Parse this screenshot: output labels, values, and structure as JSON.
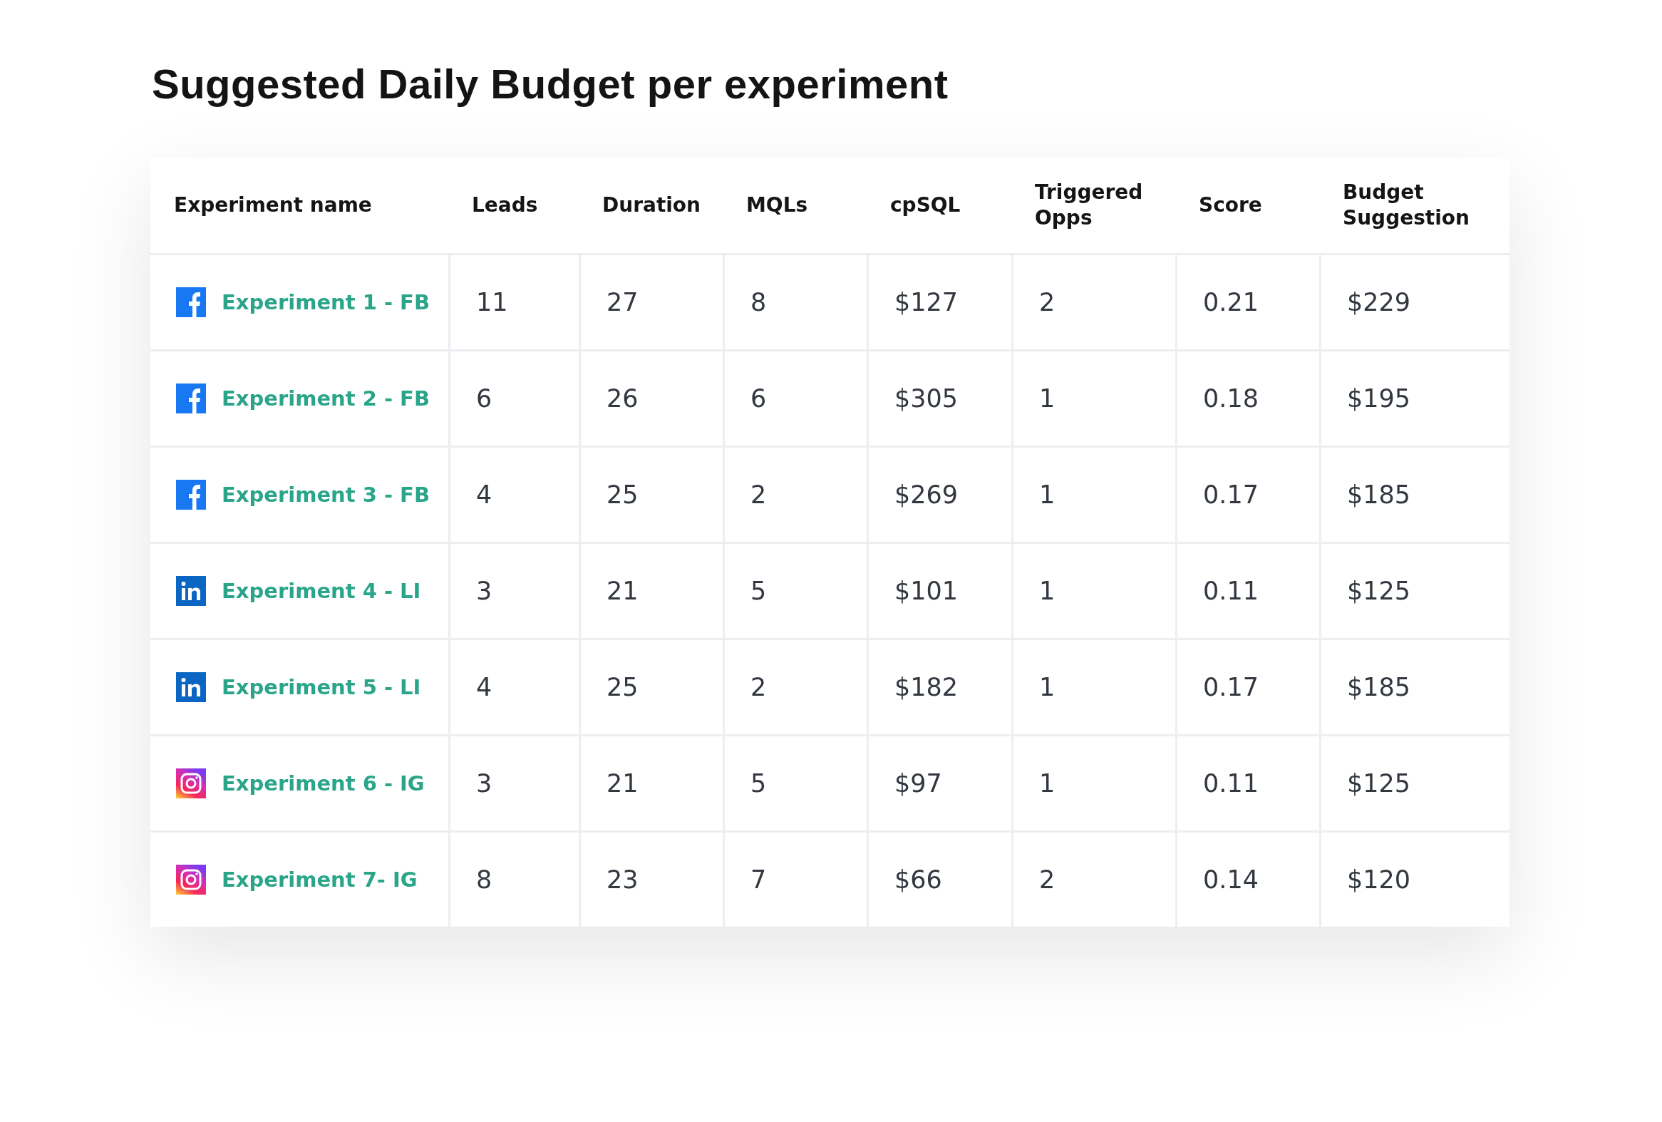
{
  "title": "Suggested Daily Budget per experiment",
  "table": {
    "columns": [
      "Experiment name",
      "Leads",
      "Duration",
      "MQLs",
      "cpSQL",
      "Triggered Opps",
      "Score",
      "Budget Suggestion"
    ],
    "rows": [
      {
        "kind": "facebook",
        "cells": [
          "Experiment 1 - FB",
          "11",
          "27",
          "8",
          "$127",
          "2",
          "0.21",
          "$229"
        ]
      },
      {
        "kind": "facebook",
        "cells": [
          "Experiment 2 - FB",
          "6",
          "26",
          "6",
          "$305",
          "1",
          "0.18",
          "$195"
        ]
      },
      {
        "kind": "facebook",
        "cells": [
          "Experiment 3 - FB",
          "4",
          "25",
          "2",
          "$269",
          "1",
          "0.17",
          "$185"
        ]
      },
      {
        "kind": "linkedin",
        "cells": [
          "Experiment 4 - LI",
          "3",
          "21",
          "5",
          "$101",
          "1",
          "0.11",
          "$125"
        ]
      },
      {
        "kind": "linkedin",
        "cells": [
          "Experiment 5 - LI",
          "4",
          "25",
          "2",
          "$182",
          "1",
          "0.17",
          "$185"
        ]
      },
      {
        "kind": "instagram",
        "cells": [
          "Experiment 6 - IG",
          "3",
          "21",
          "5",
          "$97",
          "1",
          "0.11",
          "$125"
        ]
      },
      {
        "kind": "instagram",
        "cells": [
          "Experiment 7- IG",
          "8",
          "23",
          "7",
          "$66",
          "2",
          "0.14",
          "$120"
        ]
      }
    ]
  }
}
